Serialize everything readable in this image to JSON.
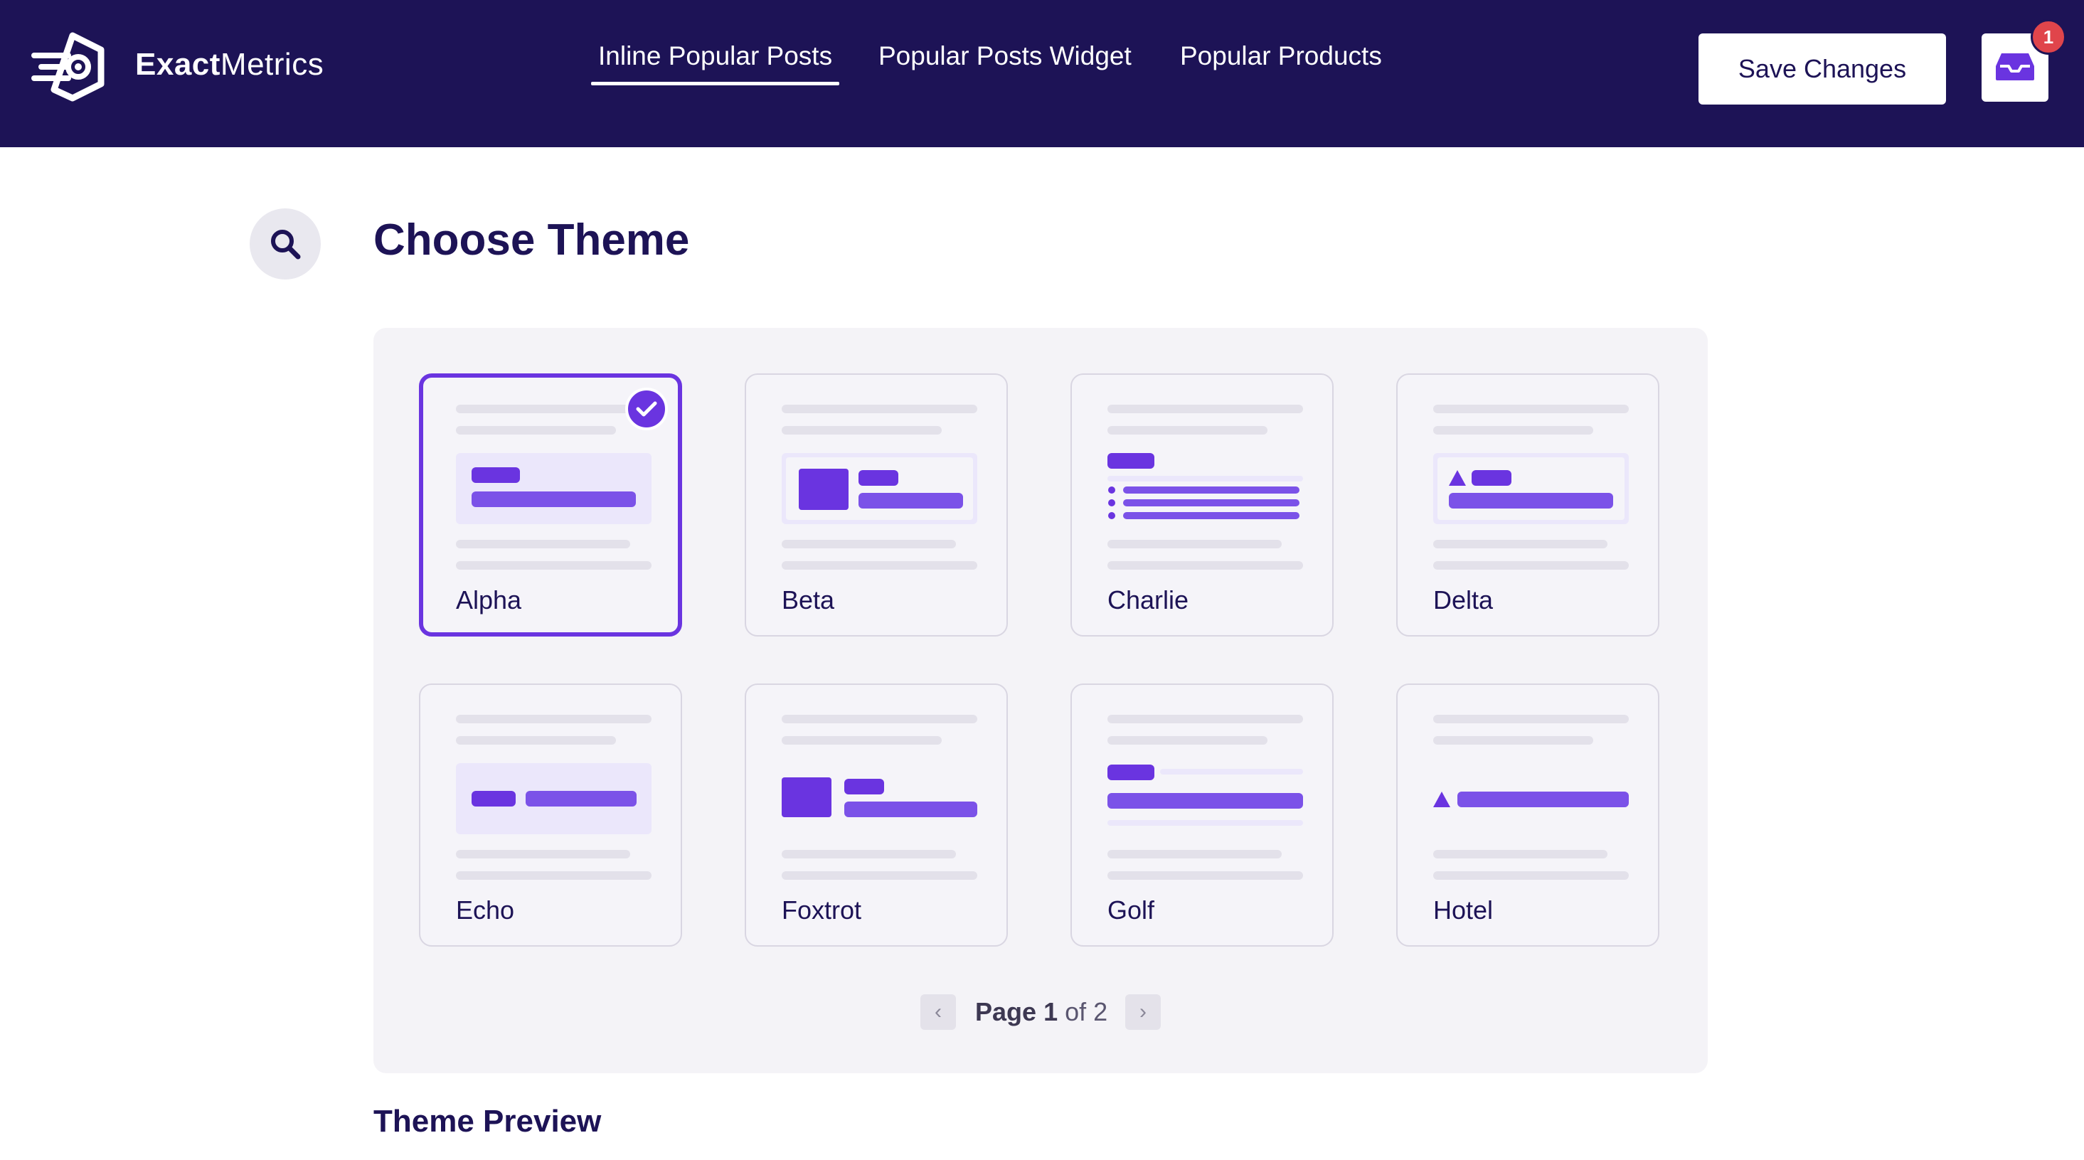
{
  "brand": {
    "name_bold": "Exact",
    "name_light": "Metrics"
  },
  "nav": {
    "items": [
      {
        "label": "Inline Popular Posts",
        "active": true
      },
      {
        "label": "Popular Posts Widget",
        "active": false
      },
      {
        "label": "Popular Products",
        "active": false
      }
    ]
  },
  "header": {
    "save_label": "Save Changes",
    "notification_count": "1"
  },
  "main": {
    "title": "Choose Theme",
    "preview_title": "Theme Preview"
  },
  "themes": [
    {
      "name": "Alpha",
      "selected": true
    },
    {
      "name": "Beta",
      "selected": false
    },
    {
      "name": "Charlie",
      "selected": false
    },
    {
      "name": "Delta",
      "selected": false
    },
    {
      "name": "Echo",
      "selected": false
    },
    {
      "name": "Foxtrot",
      "selected": false
    },
    {
      "name": "Golf",
      "selected": false
    },
    {
      "name": "Hotel",
      "selected": false
    }
  ],
  "pagination": {
    "page_word": "Page",
    "current": "1",
    "of_word": "of",
    "total": "2",
    "prev_symbol": "‹",
    "next_symbol": "›"
  },
  "colors": {
    "header_bg": "#1d1356",
    "accent": "#6a34e0",
    "accent_light": "#7b52e8",
    "badge": "#e0454b"
  },
  "icons": {
    "logo": "exactmetrics-logo-icon",
    "search": "search-icon",
    "inbox": "inbox-icon",
    "check": "check-icon"
  }
}
